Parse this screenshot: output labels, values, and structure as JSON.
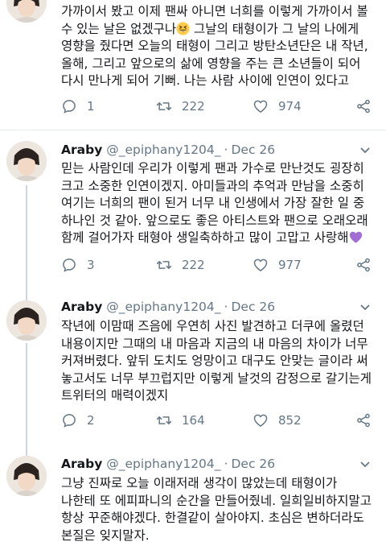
{
  "tweets": [
    {
      "text": "가까이서 봤고 이제 팬싸 아니면 너희를 이렇게 가까이서 볼 수 있는 날은 없겠구나😆 그날의 태형이가 그 날의 나에게 영향을 줬다면 오늘의 태형이 그리고 방탄소년단은 내 작년, 올해, 그리고 앞으로의 삶에 영향을 주는 큰 소년들이 되어 다시 만나게 되어 기뻐. 나는 사람 사이에 인연이 있다고",
      "text_before_emoji": "가까이서 봤고 이제 팬싸 아니면 너희를 이렇게 가까이서 볼 수 있는 날은 없겠구나",
      "emoji": "grinning-squinting-face",
      "text_after_emoji": " 그날의 태형이가 그 날의 나에게 영향을 줬다면 오늘의 태형이 그리고 방탄소년단은 내 작년, 올해, 그리고 앞으로의 삶에 영향을 주는 큰 소년들이 되어 다시 만나게 되어 기뻐. 나는 사람 사이에 인연이 있다고",
      "replies": "1",
      "retweets": "222",
      "likes": "974"
    },
    {
      "name": "Araby",
      "handle": "@_epiphany1204_",
      "date": "Dec 26",
      "text_before_emoji": "믿는 사람인데 우리가 이렇게 팬과 가수로 만난것도 굉장히 크고 소중한 인연이겠지. 아미들과의 추억과 만남을 소중히 여기는 너희의 팬이 된거 너무 내 인생에서 가장 잘한 일 중 하나인 것 같아. 앞으로도 좋은 아티스트와 팬으로 오래오래 함께 걸어가자 태형아 생일축하하고 많이 고맙고 사랑해",
      "emoji": "purple-heart",
      "replies": "3",
      "retweets": "222",
      "likes": "977"
    },
    {
      "name": "Araby",
      "handle": "@_epiphany1204_",
      "date": "Dec 26",
      "text": "작년에 이맘때 즈음에 우연히 사진 발견하고 더쿠에 올렸던 내용이지만 그때의 내 마음과 지금의 내 마음의 차이가 너무 커져버렸다. 앞뒤 도치도 엉망이고 대구도 안맞는 글이라 써 놓고서도 너무 부끄럽지만 이렇게 날것의 감정으로 갈기는게 트위터의 매력이겠지",
      "replies": "2",
      "retweets": "164",
      "likes": "852"
    },
    {
      "name": "Araby",
      "handle": "@_epiphany1204_",
      "date": "Dec 26",
      "text": "그냥 진짜로 오늘 이래저래 생각이 많았는데 태형이가 나한테 또 에피파니의 순간을 만들어줬네. 일희일비하지말고 항상 꾸준해야겠다. 한결같이 살아야지.  초심은 변하더라도 본질은 잊지말자."
    }
  ],
  "colors": {
    "text": "#14171a",
    "secondary": "#657786",
    "thread_line": "#ccd6dd",
    "divider": "#e6ecf0",
    "heart_emoji": "#a36ed3"
  }
}
